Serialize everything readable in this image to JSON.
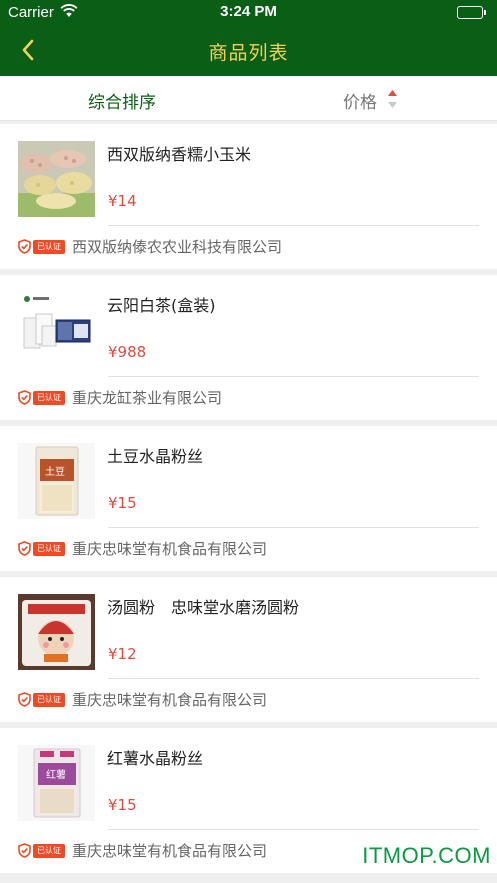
{
  "status_bar": {
    "carrier": "Carrier",
    "time": "3:24 PM",
    "wifi_icon": "wifi-icon",
    "battery_icon": "battery-icon"
  },
  "nav": {
    "title": "商品列表",
    "back_icon": "chevron-left-icon"
  },
  "sort": {
    "comprehensive_label": "综合排序",
    "price_label": "价格",
    "sort_icon": "sort-arrows-icon"
  },
  "products": [
    {
      "name": "西双版纳香糯小玉米",
      "price": "¥14",
      "badge": "已认证",
      "company": "西双版纳傣农农业科技有限公司"
    },
    {
      "name": "云阳白茶(盒装)",
      "price": "¥988",
      "badge": "已认证",
      "company": "重庆龙缸茶业有限公司"
    },
    {
      "name": "土豆水晶粉丝",
      "price": "¥15",
      "badge": "已认证",
      "company": "重庆忠味堂有机食品有限公司"
    },
    {
      "name": "汤圆粉　忠味堂水磨汤圆粉",
      "price": "¥12",
      "badge": "已认证",
      "company": "重庆忠味堂有机食品有限公司"
    },
    {
      "name": "红薯水晶粉丝",
      "price": "¥15",
      "badge": "已认证",
      "company": "重庆忠味堂有机食品有限公司"
    }
  ],
  "watermark": "ITMOP.COM",
  "colors": {
    "header_bg": "#0a5e16",
    "title": "#f3d25a",
    "price": "#e24a3b",
    "badge": "#f04a24",
    "active_sort": "#0a5e16"
  }
}
